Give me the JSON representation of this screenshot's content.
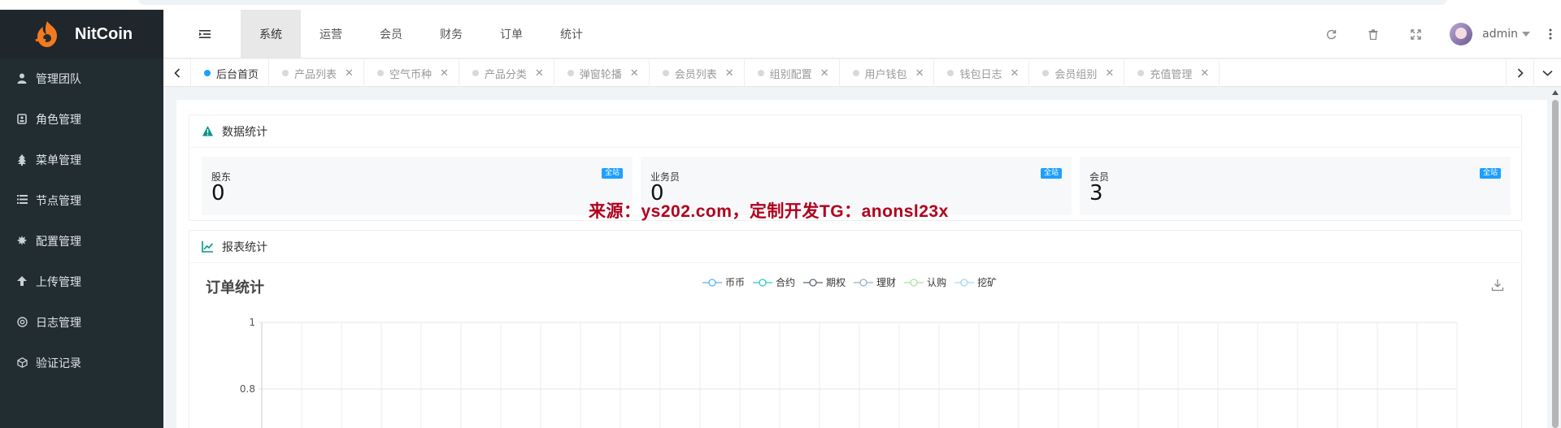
{
  "brand": {
    "name": "NitCoin"
  },
  "sidebar": {
    "items": [
      {
        "label": "管理团队",
        "icon": "user-icon"
      },
      {
        "label": "角色管理",
        "icon": "id-card-icon"
      },
      {
        "label": "菜单管理",
        "icon": "tree-icon"
      },
      {
        "label": "节点管理",
        "icon": "list-icon"
      },
      {
        "label": "配置管理",
        "icon": "gear-icon"
      },
      {
        "label": "上传管理",
        "icon": "upload-arrow-icon"
      },
      {
        "label": "日志管理",
        "icon": "log-icon"
      },
      {
        "label": "验证记录",
        "icon": "cube-icon"
      }
    ]
  },
  "header": {
    "nav": [
      "系统",
      "运营",
      "会员",
      "财务",
      "订单",
      "统计"
    ],
    "active_nav": "系统",
    "username": "admin"
  },
  "tabs": {
    "items": [
      "后台首页",
      "产品列表",
      "空气币种",
      "产品分类",
      "弹窗轮播",
      "会员列表",
      "组别配置",
      "用户钱包",
      "钱包日志",
      "会员组别",
      "充值管理"
    ],
    "active": "后台首页"
  },
  "stats_card": {
    "title": "数据统计",
    "items": [
      {
        "label": "股东",
        "value": "0",
        "badge": "全站"
      },
      {
        "label": "业务员",
        "value": "0",
        "badge": "全站"
      },
      {
        "label": "会员",
        "value": "3",
        "badge": "全站"
      }
    ]
  },
  "watermark": "来源：ys202.com，定制开发TG：anonsl23x",
  "report_card": {
    "title": "报表统计"
  },
  "chart_data": {
    "type": "line",
    "title": "订单统计",
    "series": [
      {
        "name": "币币",
        "color": "#5ab1ef",
        "values": []
      },
      {
        "name": "合约",
        "color": "#2ec7c9",
        "values": []
      },
      {
        "name": "期权",
        "color": "#5a6776",
        "values": []
      },
      {
        "name": "理财",
        "color": "#97b0c8",
        "values": []
      },
      {
        "name": "认购",
        "color": "#a6e3a1",
        "values": []
      },
      {
        "name": "挖矿",
        "color": "#a2d6f4",
        "values": []
      }
    ],
    "y_ticks": [
      "1",
      "0.8"
    ],
    "ylim": [
      0,
      1
    ],
    "x_gridlines": 30,
    "grid": true
  },
  "colors": {
    "sidebar_bg": "#222d32",
    "accent": "#1e9fff",
    "watermark": "#b1001c"
  }
}
